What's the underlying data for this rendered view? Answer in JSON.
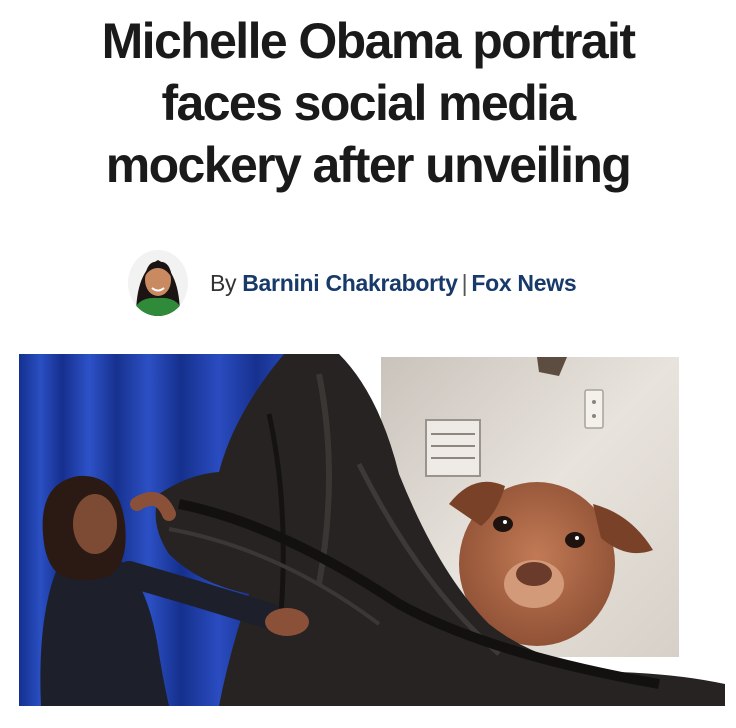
{
  "article": {
    "headline_lines": [
      "Michelle Obama portrait",
      "faces social media",
      "mockery after unveiling"
    ],
    "byline": {
      "prefix": "By",
      "author": "Barnini Chakraborty",
      "separator": "|",
      "outlet": "Fox News"
    }
  },
  "colors": {
    "headline": "#1a1a1a",
    "byline_link": "#183a6b",
    "curtain_blue": "#1f3fa8",
    "drape": "#242221",
    "dog_fur": "#b06a48"
  }
}
